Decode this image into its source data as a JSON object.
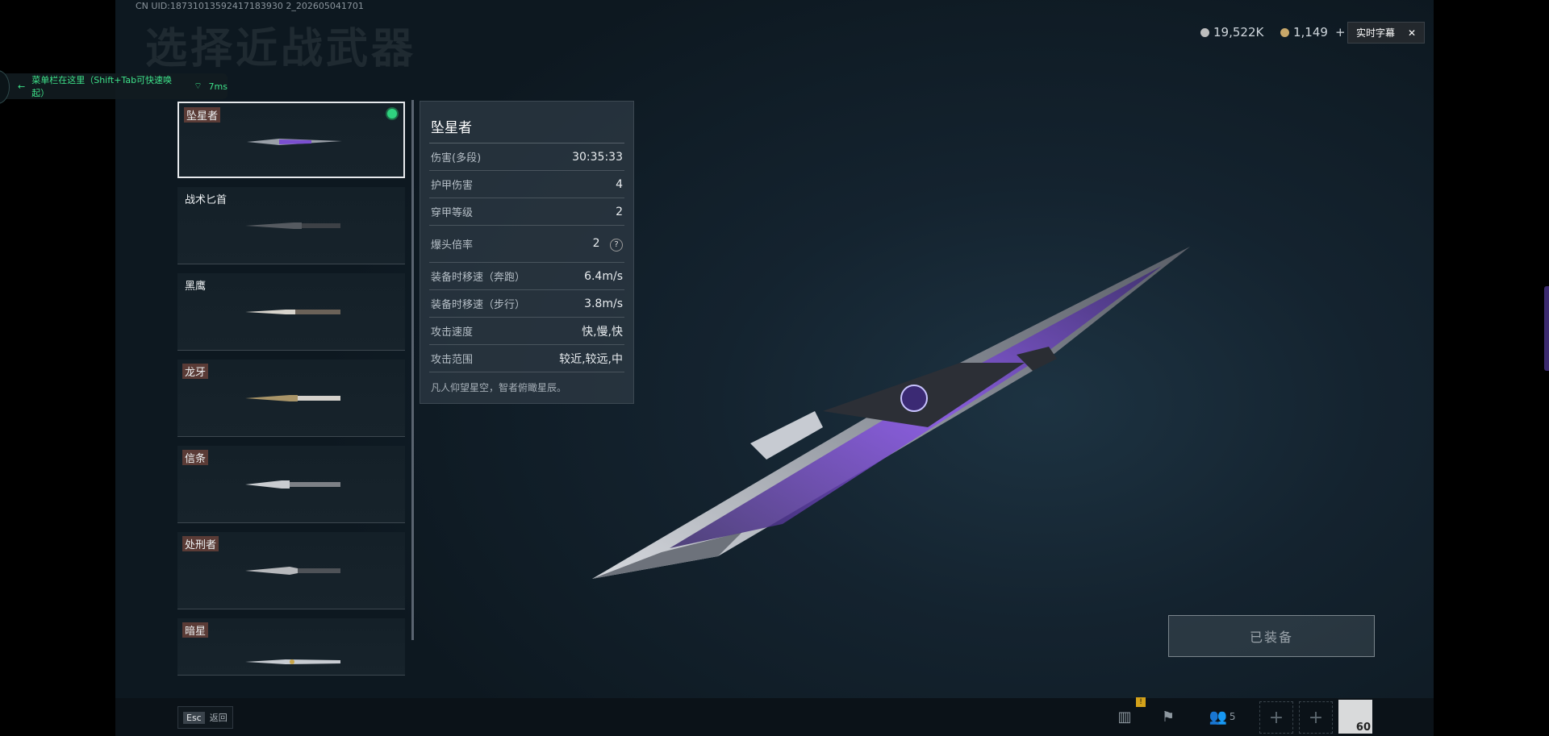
{
  "uid": "CN UID:18731013592417183930 2_202605041701",
  "page_title": "选择近战武器",
  "currency": [
    {
      "value": "19,522K",
      "color": "#c9c9c9"
    },
    {
      "value": "1,149",
      "color": "#c8a86a",
      "plus": "+"
    }
  ],
  "subtitle_button": {
    "label": "实时字幕",
    "close": "✕"
  },
  "menu_tip": {
    "text": "菜单栏在这里（Shift+Tab可快速唤起）",
    "ping": "7ms"
  },
  "weapons": [
    {
      "name": "坠星者",
      "tagged": true,
      "selected": true
    },
    {
      "name": "战术匕首",
      "tagged": false
    },
    {
      "name": "黑鹰",
      "tagged": false
    },
    {
      "name": "龙牙",
      "tagged": true
    },
    {
      "name": "信条",
      "tagged": true
    },
    {
      "name": "处刑者",
      "tagged": true
    },
    {
      "name": "暗星",
      "tagged": true
    }
  ],
  "stats": {
    "title": "坠星者",
    "rows": [
      {
        "label": "伤害(多段)",
        "value": "30:35:33"
      },
      {
        "label": "护甲伤害",
        "value": "4"
      },
      {
        "label": "穿甲等级",
        "value": "2"
      },
      {
        "label": "爆头倍率",
        "value": "2",
        "help": "?"
      },
      {
        "label": "装备时移速（奔跑）",
        "value": "6.4m/s"
      },
      {
        "label": "装备时移速（步行）",
        "value": "3.8m/s"
      },
      {
        "label": "攻击速度",
        "value": "快,慢,快"
      },
      {
        "label": "攻击范围",
        "value": "较近,较远,中"
      }
    ],
    "description": "凡人仰望星空，智者俯瞰星辰。"
  },
  "equip_button": "已装备",
  "bottom_bar": {
    "esc_key": "Esc",
    "esc_label": "返回",
    "badge": "!",
    "squad_count": "5",
    "level": "60"
  },
  "accent": "#7b3fe0"
}
